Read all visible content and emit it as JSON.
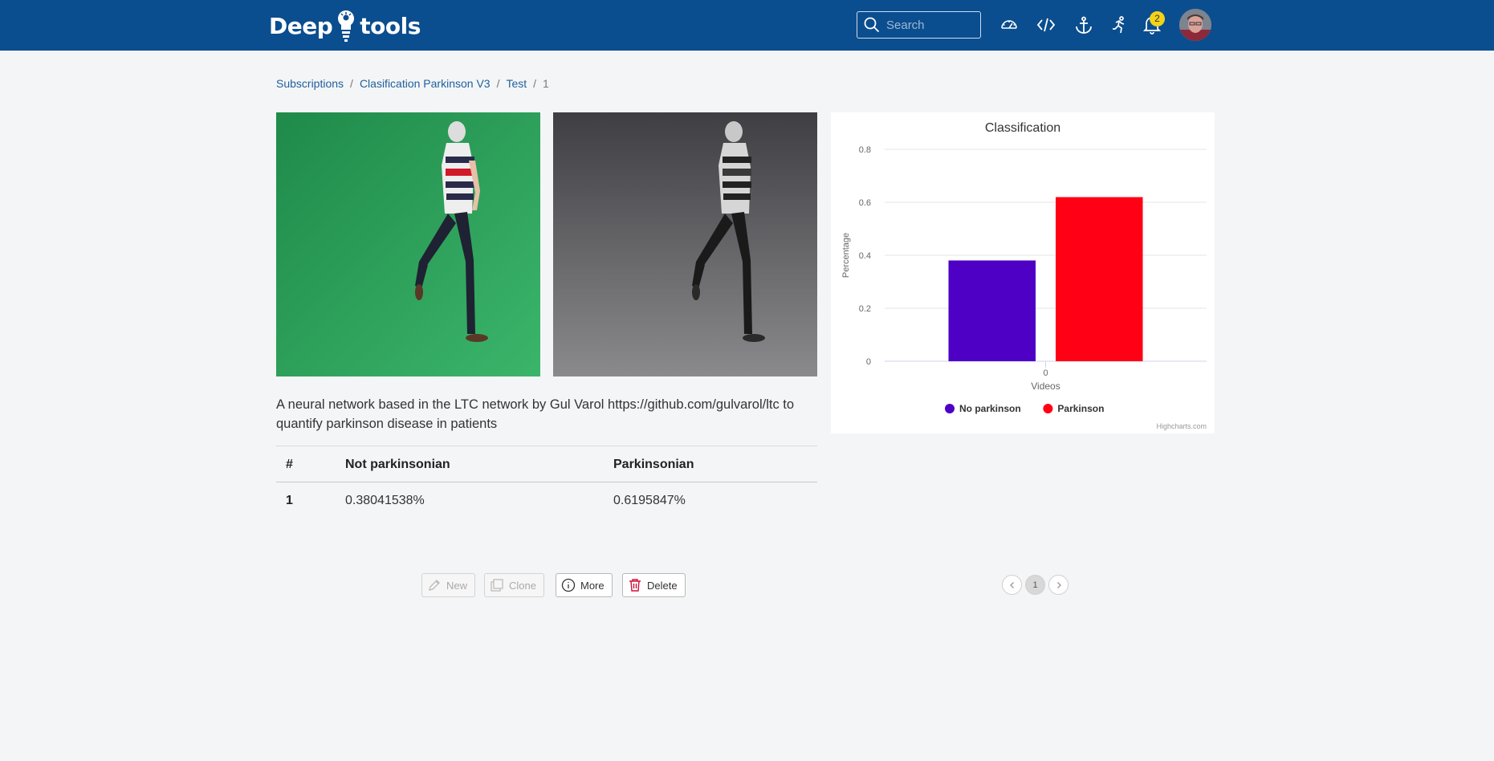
{
  "header": {
    "logo_left": "Deep",
    "logo_right": "tools",
    "search_placeholder": "Search",
    "notifications_count": "2",
    "icons": [
      "dashboard-icon",
      "code-icon",
      "anchor-icon",
      "running-person-icon",
      "bell-icon"
    ]
  },
  "breadcrumb": {
    "items": [
      "Subscriptions",
      "Clasification Parkinson V3",
      "Test",
      "1"
    ]
  },
  "media": {
    "frame_color_bg": "#2fa85c",
    "frame_gray_bg": "#5c5c60"
  },
  "description": "A neural network based in the LTC network by Gul Varol https://github.com/gulvarol/ltc to quantify parkinson disease in patients",
  "table": {
    "headers": [
      "#",
      "Not parkinsonian",
      "Parkinsonian"
    ],
    "rows": [
      [
        "1",
        "0.38041538%",
        "0.6195847%"
      ]
    ]
  },
  "chart_data": {
    "type": "bar",
    "title": "Classification",
    "xlabel": "Videos",
    "ylabel": "Percentage",
    "categories": [
      "0"
    ],
    "ylim": [
      0,
      0.8
    ],
    "yticks": [
      "0",
      "0.2",
      "0.4",
      "0.6",
      "0.8"
    ],
    "series": [
      {
        "name": "No parkinson",
        "values": [
          0.38041538
        ],
        "color": "#4e00c4"
      },
      {
        "name": "Parkinson",
        "values": [
          0.6195847
        ],
        "color": "#ff0014"
      }
    ],
    "legend": "bottom-center",
    "credits": "Highcharts.com",
    "grid": true
  },
  "actions": {
    "new_label": "New",
    "clone_label": "Clone",
    "more_label": "More",
    "delete_label": "Delete"
  },
  "pagination": {
    "current": "1"
  }
}
